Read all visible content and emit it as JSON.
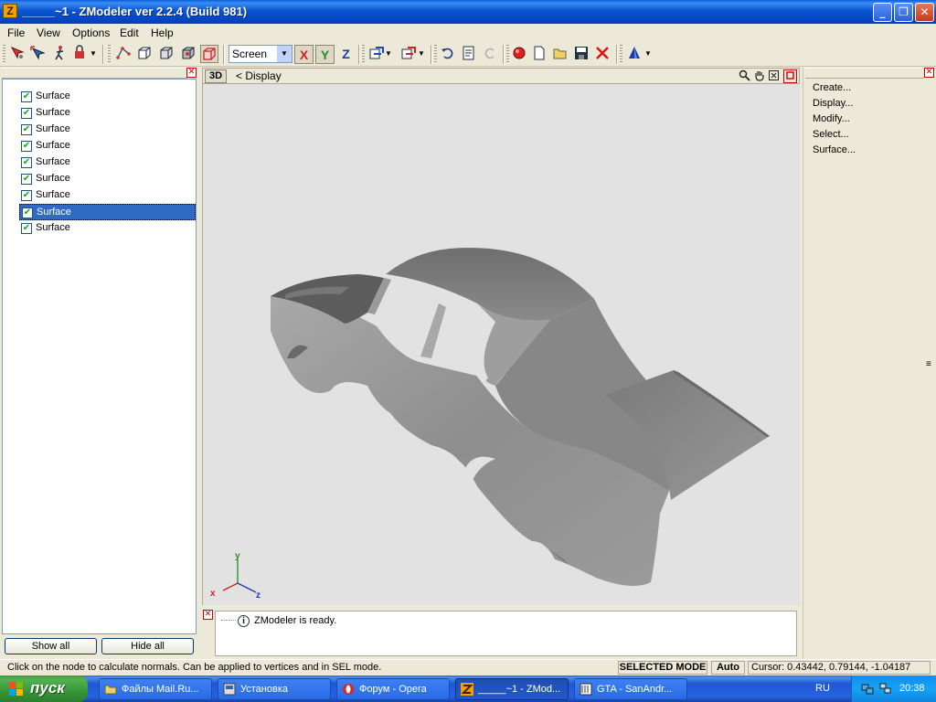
{
  "window": {
    "title": "_____~1 - ZModeler ver 2.2.4 (Build 981)",
    "app_icon_letter": "Z",
    "minimize_glyph": "_",
    "maximize_glyph": "❐",
    "close_glyph": "✕"
  },
  "menu": {
    "file": "File",
    "view": "View",
    "options": "Options",
    "edit": "Edit",
    "help": "Help"
  },
  "toolbar": {
    "view_select": "Screen",
    "axis_x": "X",
    "axis_y": "Y",
    "axis_z": "Z",
    "icons": [
      "select-icon",
      "move-icon",
      "figure-icon",
      "lock-icon",
      "vertex-mode-icon",
      "box-mode-icon",
      "face-mode-icon",
      "object-mode-icon",
      "undo-icon",
      "properties-icon",
      "redo-icon",
      "render-icon",
      "new-file-icon",
      "open-folder-icon",
      "save-icon",
      "delete-icon",
      "material-icon"
    ]
  },
  "left_panel": {
    "items": [
      {
        "label": "Surface",
        "checked": true,
        "selected": false
      },
      {
        "label": "Surface",
        "checked": true,
        "selected": false
      },
      {
        "label": "Surface",
        "checked": true,
        "selected": false
      },
      {
        "label": "Surface",
        "checked": true,
        "selected": false
      },
      {
        "label": "Surface",
        "checked": true,
        "selected": false
      },
      {
        "label": "Surface",
        "checked": true,
        "selected": false
      },
      {
        "label": "Surface",
        "checked": true,
        "selected": false
      },
      {
        "label": "Surface",
        "checked": true,
        "selected": true
      },
      {
        "label": "Surface",
        "checked": true,
        "selected": false
      }
    ],
    "show_all": "Show all",
    "hide_all": "Hide all"
  },
  "viewport": {
    "mode": "3D",
    "label": "<  Display",
    "background": "#e2e2e2",
    "axes": {
      "x": "x",
      "y": "y",
      "z": "z"
    }
  },
  "right_panel": {
    "items": [
      "Create...",
      "Display...",
      "Modify...",
      "Select...",
      "Surface..."
    ]
  },
  "log": {
    "message": "ZModeler is ready."
  },
  "statusbar": {
    "message": "Click on the node to calculate normals. Can be applied to vertices and in SEL mode.",
    "mode": "SELECTED MODE",
    "auto": "Auto",
    "cursor": "Cursor: 0.43442, 0.79144, -1.04187"
  },
  "taskbar": {
    "start": "пуск",
    "tasks": [
      {
        "label": "Файлы Mail.Ru...",
        "icon": "folder-icon"
      },
      {
        "label": "Установка",
        "icon": "installer-icon"
      },
      {
        "label": "Форум - Opera",
        "icon": "opera-icon"
      },
      {
        "label": "_____~1 - ZMod...",
        "icon": "zmodeler-icon"
      },
      {
        "label": "GTA - SanAndr...",
        "icon": "gta-icon"
      }
    ],
    "language": "RU",
    "clock": "20:38"
  }
}
